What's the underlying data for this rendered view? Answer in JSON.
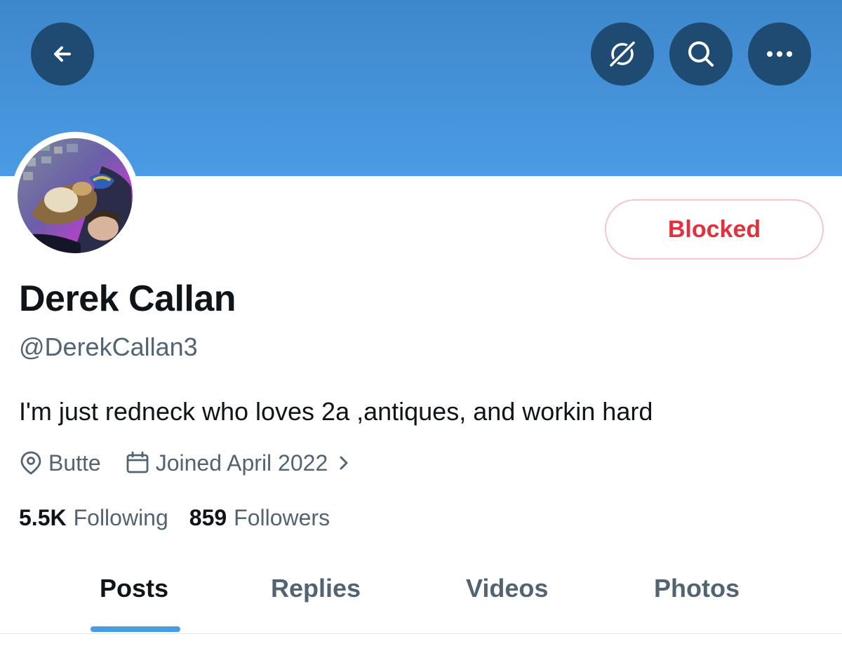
{
  "header": {
    "back_icon": "arrow-left-icon",
    "grok_icon": "grok-icon",
    "search_icon": "search-icon",
    "more_icon": "more-horizontal-icon",
    "banner_color": "#4a9be4",
    "button_color": "#1f4b73"
  },
  "profile": {
    "display_name": "Derek Callan",
    "handle": "@DerekCallan3",
    "bio": "I'm just redneck who loves 2a ,antiques, and workin hard",
    "location": "Butte",
    "joined": "Joined April 2022",
    "action_button": "Blocked",
    "action_color": "#e0313d"
  },
  "stats": {
    "following_count": "5.5K",
    "following_label": "Following",
    "followers_count": "859",
    "followers_label": "Followers"
  },
  "tabs": [
    {
      "label": "Posts",
      "active": true
    },
    {
      "label": "Replies",
      "active": false
    },
    {
      "label": "Videos",
      "active": false
    },
    {
      "label": "Photos",
      "active": false
    }
  ],
  "accent_color": "#4a9be4"
}
